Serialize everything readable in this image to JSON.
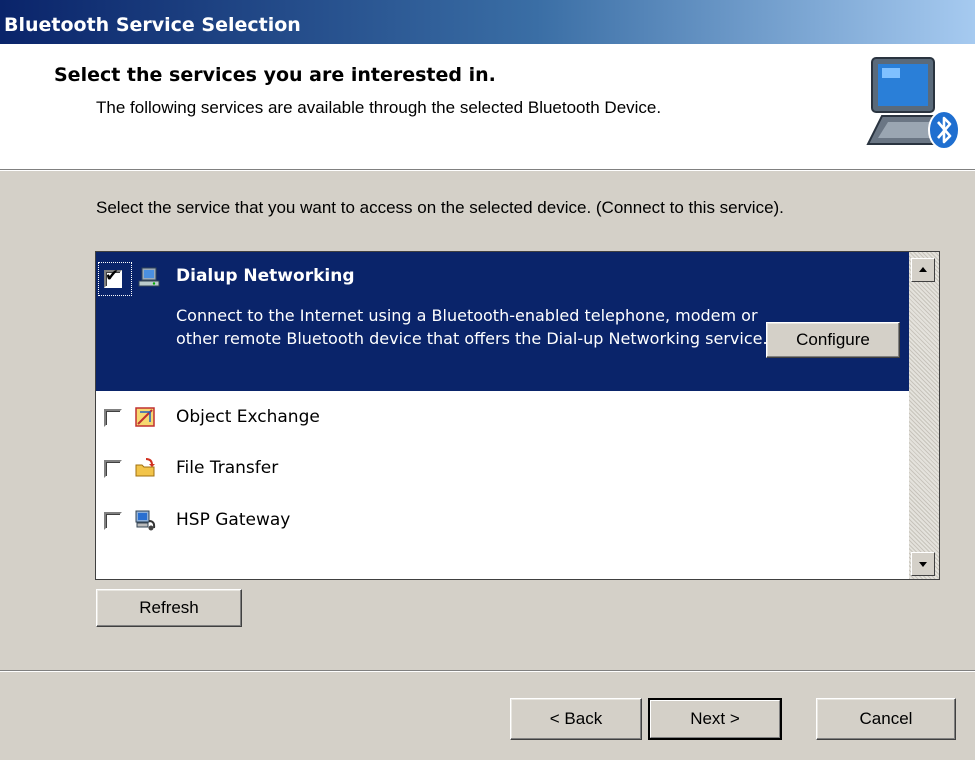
{
  "window": {
    "title": "Bluetooth Service Selection"
  },
  "header": {
    "title": "Select the services you are interested in.",
    "subtitle": "The following services are available through the selected Bluetooth Device.",
    "icon": "bluetooth-computer-icon"
  },
  "instructions": "Select the service that you want to access on the selected device. (Connect to this service).",
  "services": [
    {
      "name": "Dialup Networking",
      "checked": true,
      "selected": true,
      "icon": "dialup-networking-icon",
      "description": "Connect to the Internet using a Bluetooth-enabled telephone, modem or other remote Bluetooth device that offers the Dial-up Networking service.",
      "action_label": "Configure"
    },
    {
      "name": "Object Exchange",
      "checked": false,
      "selected": false,
      "icon": "object-exchange-icon"
    },
    {
      "name": "File Transfer",
      "checked": false,
      "selected": false,
      "icon": "file-transfer-icon"
    },
    {
      "name": "HSP Gateway",
      "checked": false,
      "selected": false,
      "icon": "hsp-gateway-icon"
    }
  ],
  "buttons": {
    "refresh_label": "Refresh",
    "back_label": "< Back",
    "next_label": "Next >",
    "cancel_label": "Cancel"
  },
  "colors": {
    "selection": "#0a246a",
    "title_gradient_start": "#0a246a",
    "title_gradient_end": "#a6caf0",
    "dialog_face": "#d4d0c8"
  }
}
